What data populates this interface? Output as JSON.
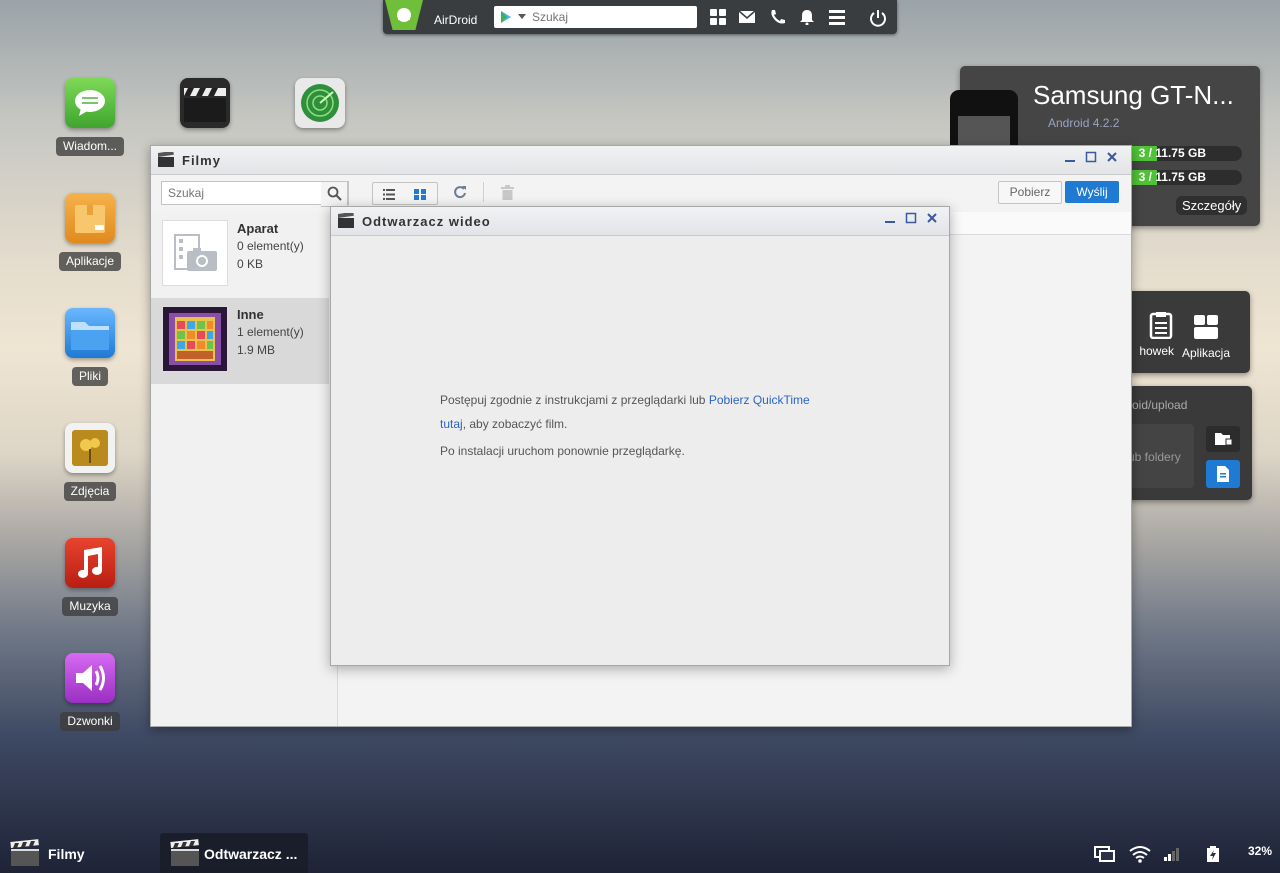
{
  "topbar": {
    "brand": "AirDroid",
    "search_placeholder": "Szukaj",
    "accent": "#6fbf3a"
  },
  "desktop": {
    "icons": [
      {
        "label": "Wiadom...",
        "icon": "messages-icon"
      },
      {
        "label": "Aplikacje",
        "icon": "apps-icon"
      },
      {
        "label": "Pliki",
        "icon": "folder-icon"
      },
      {
        "label": "Zdjęcia",
        "icon": "photos-icon"
      },
      {
        "label": "Muzyka",
        "icon": "music-icon"
      },
      {
        "label": "Dzwonki",
        "icon": "ringtones-icon"
      }
    ]
  },
  "device": {
    "name": "Samsung GT-N...",
    "android_version": "Android 4.2.2",
    "storage": [
      {
        "text": "3 / 11.75 GB",
        "fill": 0.48
      },
      {
        "text": "3 / 11.75 GB",
        "fill": 0.48
      }
    ],
    "details_label": "Szczegóły"
  },
  "tools_panel": {
    "items": [
      {
        "label": "howek",
        "icon": "clipboard-icon"
      },
      {
        "label": "Aplikacja",
        "icon": "app-box-icon"
      }
    ]
  },
  "upload_panel": {
    "path": "roid/upload",
    "drop_text": "ub foldery"
  },
  "filmy_window": {
    "title": "Filmy",
    "search_placeholder": "Szukaj",
    "download_label": "Pobierz",
    "send_label": "Wyślij",
    "albums": [
      {
        "name": "Aparat",
        "count": "0 element(y)",
        "size": "0 KB"
      },
      {
        "name": "Inne",
        "count": "1 element(y)",
        "size": "1.9 MB"
      }
    ]
  },
  "player_window": {
    "title": "Odtwarzacz wideo",
    "message_prefix": "Postępuj zgodnie z instrukcjami z przeglądarki lub ",
    "link_quicktime": "Pobierz QuickTime",
    "link_here": "tutaj",
    "message_suffix": ", aby zobaczyć film.",
    "reinstall_note": "Po instalacji uruchom ponownie przeglądarkę."
  },
  "taskbar": {
    "tasks": [
      {
        "label": "Filmy"
      },
      {
        "label": "Odtwarzacz ..."
      }
    ],
    "battery": "32%"
  }
}
